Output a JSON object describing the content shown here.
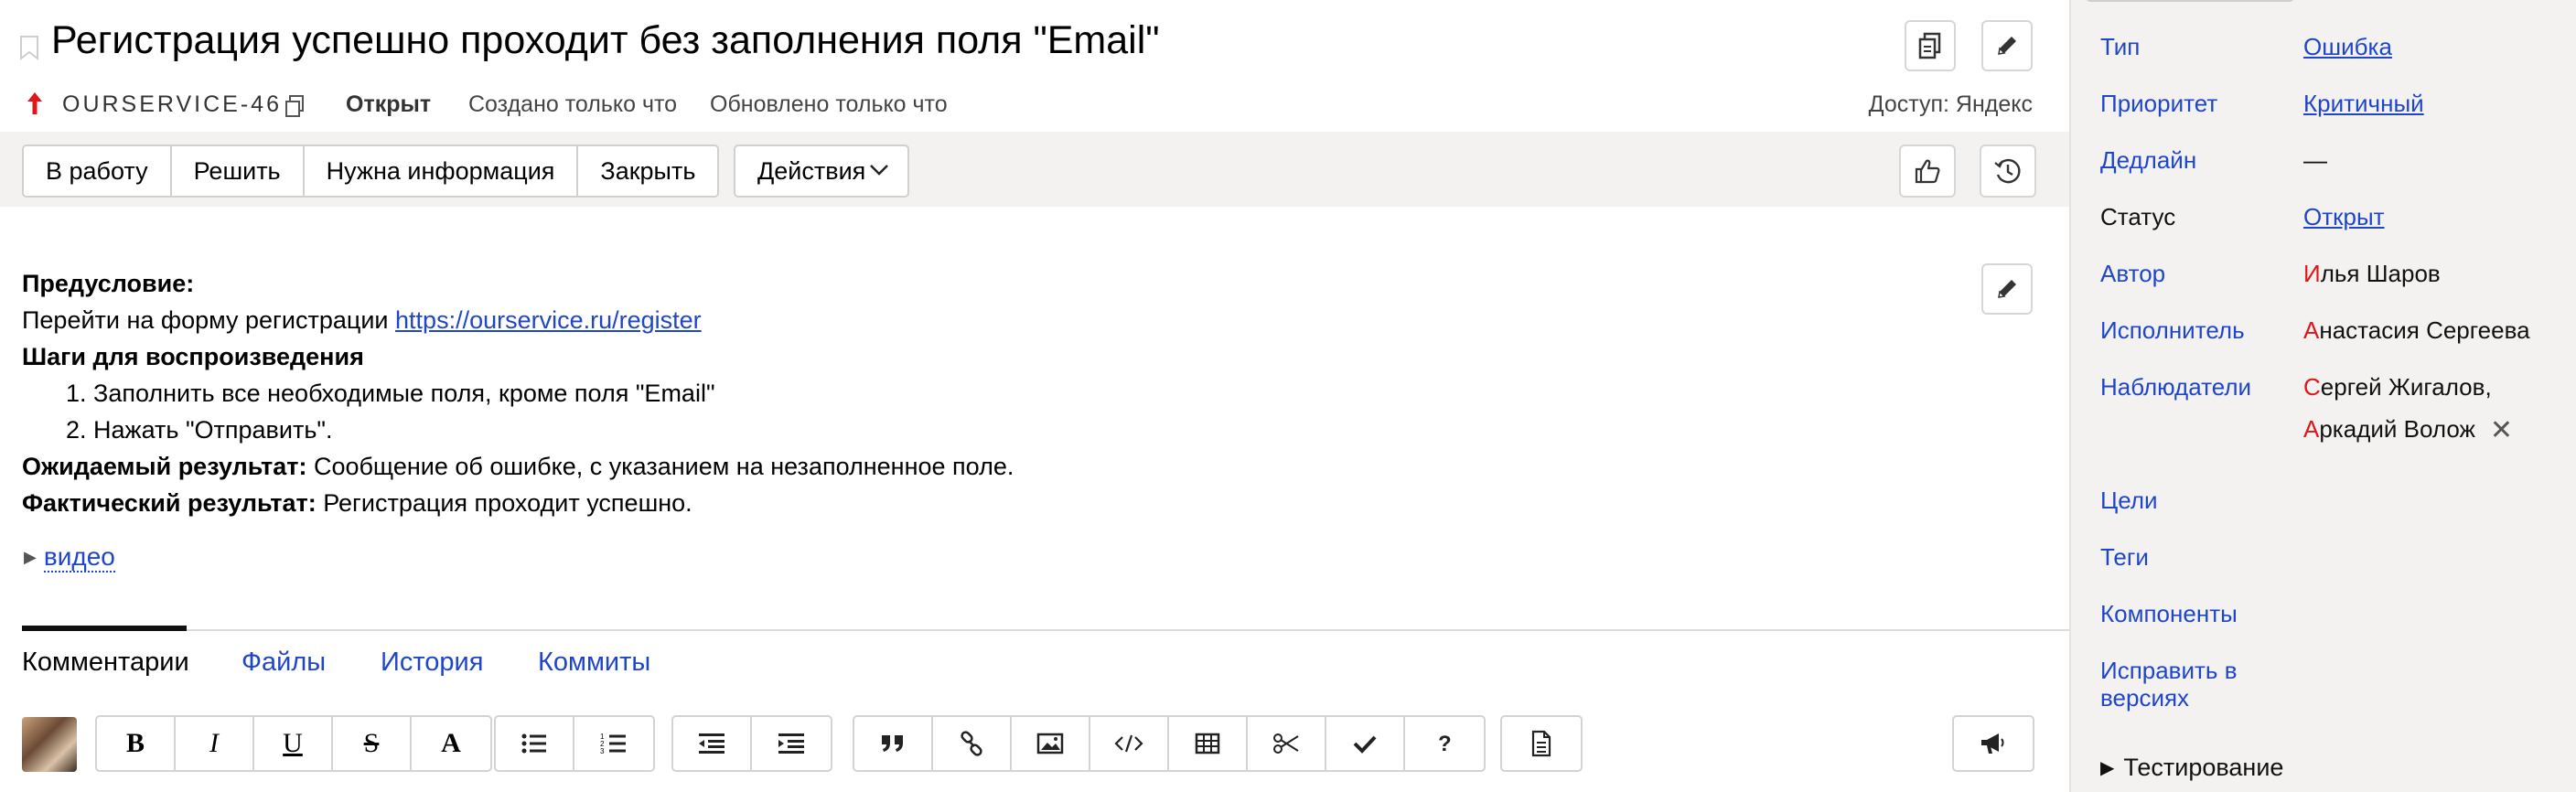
{
  "issue": {
    "title": "Регистрация успешно проходит без заполнения поля \"Email\"",
    "key": "OURSERVICE-46",
    "status": "Открыт",
    "created": "Создано только что",
    "updated": "Обновлено только что",
    "access": "Доступ: Яндекс"
  },
  "toolbar": {
    "workflow": [
      "В работу",
      "Решить",
      "Нужна информация",
      "Закрыть"
    ],
    "actions_label": "Действия"
  },
  "description": {
    "precondition_label": "Предусловие:",
    "precondition_text": "Перейти на форму регистрации ",
    "precondition_link": "https://ourservice.ru/register",
    "steps_label": "Шаги для воспроизведения",
    "steps": [
      "1. Заполнить все необходимые поля, кроме поля \"Email\"",
      "2. Нажать \"Отправить\"."
    ],
    "expected_label": "Ожидаемый результат:",
    "expected_text": " Сообщение об ошибке, с указанием на незаполненное поле.",
    "actual_label": "Фактический результат:",
    "actual_text": " Регистрация проходит успешно.",
    "video_label": "видео"
  },
  "tabs": [
    "Комментарии",
    "Файлы",
    "История",
    "Коммиты"
  ],
  "editor": {
    "format_buttons": [
      "B",
      "I",
      "U",
      "S",
      "A"
    ],
    "icon_names": [
      "bulleted-list-icon",
      "numbered-list-icon",
      "outdent-icon",
      "indent-icon",
      "quote-icon",
      "link-icon",
      "image-icon",
      "code-icon",
      "table-icon",
      "cut-icon",
      "checkmark-icon",
      "help-icon",
      "template-icon",
      "announce-icon"
    ]
  },
  "sidebar": {
    "type_label": "Тип",
    "type_value": "Ошибка",
    "priority_label": "Приоритет",
    "priority_value": "Критичный",
    "deadline_label": "Дедлайн",
    "deadline_value": "—",
    "status_label": "Статус",
    "status_value": "Открыт",
    "author_label": "Автор",
    "author_first": "И",
    "author_rest": "лья Шаров",
    "assignee_label": "Исполнитель",
    "assignee_first": "А",
    "assignee_rest": "настасия Сергеева",
    "followers_label": "Наблюдатели",
    "follower1_first": "С",
    "follower1_rest": "ергей Жигалов,",
    "follower2_first": "А",
    "follower2_rest": "ркадий Волож",
    "goals_label": "Цели",
    "tags_label": "Теги",
    "components_label": "Компоненты",
    "fix_versions_label_1": "Исправить в",
    "fix_versions_label_2": "версиях",
    "testing_label": "Тестирование"
  },
  "colors": {
    "link": "#1f46c8",
    "priority_arrow": "#e0161b",
    "sidebar_bg": "#f3f2f1",
    "toolbar_band": "#f3f2f1"
  }
}
